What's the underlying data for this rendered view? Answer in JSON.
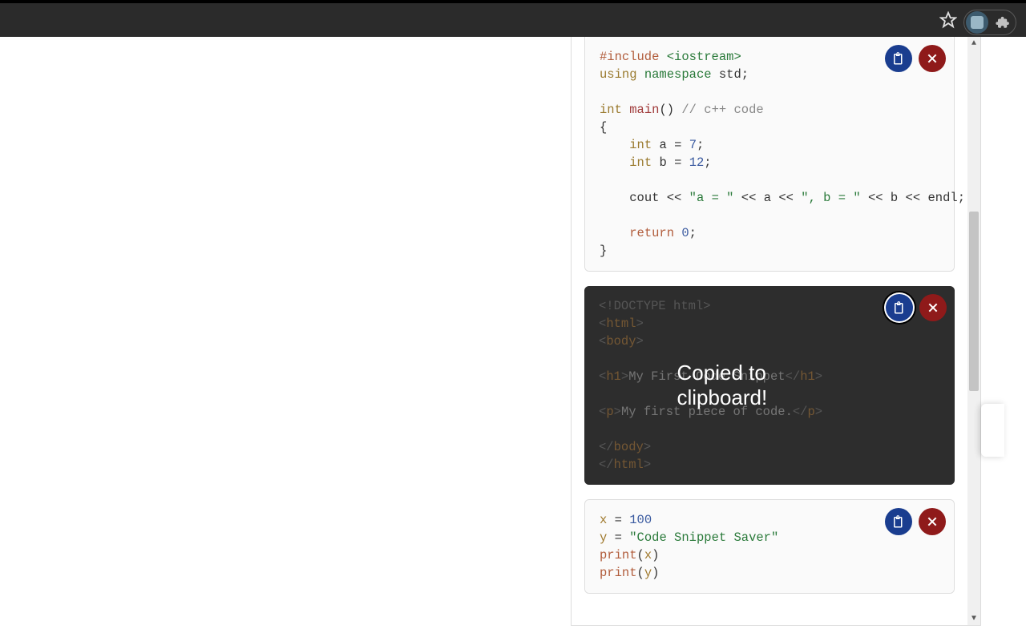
{
  "toast": "Copied to clipboard!",
  "snippets": {
    "cpp": {
      "l1_dir": "#include",
      "l1_lib": "<iostream>",
      "l2_kw": "using",
      "l2_ns": "namespace",
      "l2_id": "std",
      "l3_type": "int",
      "l3_fn": "main",
      "l3_cmt": "// c++ code",
      "l4_open": "{",
      "l5_type": "int",
      "l5_v": "a",
      "l5_eq": "=",
      "l5_n": "7",
      "l6_type": "int",
      "l6_v": "b",
      "l6_eq": "=",
      "l6_n": "12",
      "l7_cout": "cout",
      "l7_s1": "\"a = \"",
      "l7_a": "a",
      "l7_s2": "\", b = \"",
      "l7_b": "b",
      "l7_endl": "endl",
      "l8_ret": "return",
      "l8_n": "0",
      "l9_close": "}"
    },
    "html": {
      "l1": "<!DOCTYPE html>",
      "l2o": "html",
      "l3o": "body",
      "l4t": "h1",
      "l4x": "My First Code Snippet",
      "l5t": "p",
      "l5x": "My first piece of code.",
      "l6c": "body",
      "l7c": "html"
    },
    "py": {
      "l1v": "x",
      "l1n": "100",
      "l2v": "y",
      "l2s": "\"Code Snippet Saver\"",
      "l3f": "print",
      "l3a": "x",
      "l4f": "print",
      "l4a": "y"
    }
  }
}
